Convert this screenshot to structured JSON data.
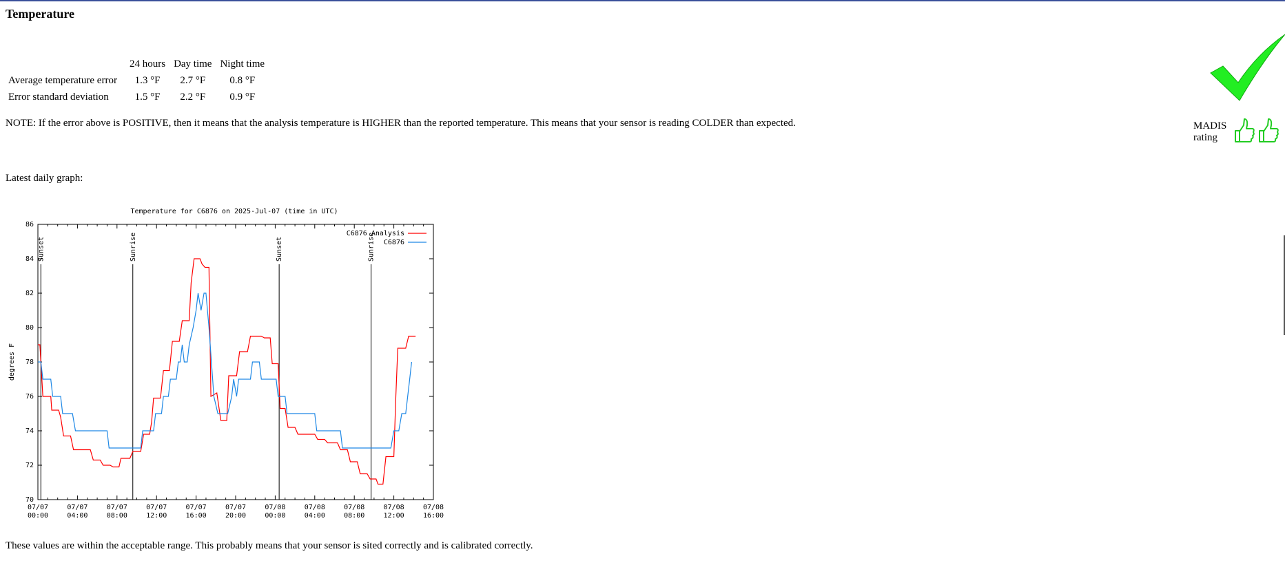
{
  "section": {
    "title": "Temperature"
  },
  "stats": {
    "columns": [
      "",
      "24 hours",
      "Day time",
      "Night time"
    ],
    "rows": [
      {
        "label": "Average temperature error",
        "values": [
          "1.3 °F",
          "2.7 °F",
          "0.8 °F"
        ]
      },
      {
        "label": "Error standard deviation",
        "values": [
          "1.5 °F",
          "2.2 °F",
          "0.9 °F"
        ]
      }
    ]
  },
  "note": "NOTE: If the error above is POSITIVE, then it means that the analysis temperature is HIGHER than the reported temperature. This means that your sensor is reading COLDER than expected.",
  "graph_label": "Latest daily graph:",
  "rating": {
    "line1": "MADIS",
    "line2": "rating",
    "status_icon": "green-checkmark",
    "thumbs_icon": "thumbs-up",
    "color": "#22dd22"
  },
  "footer": "These values are within the acceptable range. This probably means that your sensor is sited correctly and is calibrated correctly.",
  "chart_data": {
    "type": "line",
    "title": "Temperature for C6876 on 2025-Jul-07 (time in UTC)",
    "ylabel": "degrees F",
    "xlabel": "",
    "ylim": [
      70,
      86
    ],
    "xlim": [
      0,
      40
    ],
    "x_unit": "hours since 07/07 00:00 UTC",
    "yticks": [
      70,
      72,
      74,
      76,
      78,
      80,
      82,
      84,
      86
    ],
    "xticks": [
      {
        "x": 0,
        "line1": "07/07",
        "line2": "00:00"
      },
      {
        "x": 4,
        "line1": "07/07",
        "line2": "04:00"
      },
      {
        "x": 8,
        "line1": "07/07",
        "line2": "08:00"
      },
      {
        "x": 12,
        "line1": "07/07",
        "line2": "12:00"
      },
      {
        "x": 16,
        "line1": "07/07",
        "line2": "16:00"
      },
      {
        "x": 20,
        "line1": "07/07",
        "line2": "20:00"
      },
      {
        "x": 24,
        "line1": "07/08",
        "line2": "00:00"
      },
      {
        "x": 28,
        "line1": "07/08",
        "line2": "04:00"
      },
      {
        "x": 32,
        "line1": "07/08",
        "line2": "08:00"
      },
      {
        "x": 36,
        "line1": "07/08",
        "line2": "12:00"
      },
      {
        "x": 40,
        "line1": "07/08",
        "line2": "16:00"
      }
    ],
    "grid": false,
    "legend_position": "top-right",
    "events": [
      {
        "x": 0.3,
        "label": "Sunset"
      },
      {
        "x": 9.6,
        "label": "Sunrise"
      },
      {
        "x": 24.4,
        "label": "Sunset"
      },
      {
        "x": 33.7,
        "label": "Sunrise"
      }
    ],
    "series": [
      {
        "name": "C6876 Analysis",
        "color": "#ff0000",
        "points": [
          [
            0,
            79
          ],
          [
            0.2,
            79
          ],
          [
            0.3,
            78
          ],
          [
            0.5,
            76
          ],
          [
            1.3,
            76
          ],
          [
            1.4,
            75.2
          ],
          [
            2.1,
            75.2
          ],
          [
            2.3,
            74.8
          ],
          [
            2.6,
            73.7
          ],
          [
            3.3,
            73.7
          ],
          [
            3.6,
            72.9
          ],
          [
            5.3,
            72.9
          ],
          [
            5.6,
            72.3
          ],
          [
            6.3,
            72.3
          ],
          [
            6.6,
            72
          ],
          [
            7.3,
            72
          ],
          [
            7.6,
            71.9
          ],
          [
            8.2,
            71.9
          ],
          [
            8.4,
            72.4
          ],
          [
            9.3,
            72.4
          ],
          [
            9.6,
            72.8
          ],
          [
            10.4,
            72.8
          ],
          [
            10.7,
            73.8
          ],
          [
            11.3,
            73.8
          ],
          [
            11.5,
            74.5
          ],
          [
            11.7,
            75.9
          ],
          [
            12.4,
            75.9
          ],
          [
            12.7,
            77.5
          ],
          [
            13.3,
            77.5
          ],
          [
            13.6,
            79.2
          ],
          [
            14.3,
            79.2
          ],
          [
            14.6,
            80.4
          ],
          [
            15.3,
            80.4
          ],
          [
            15.5,
            82.6
          ],
          [
            15.8,
            84
          ],
          [
            16.4,
            84
          ],
          [
            16.6,
            83.7
          ],
          [
            16.9,
            83.5
          ],
          [
            17.3,
            83.5
          ],
          [
            17.5,
            76
          ],
          [
            18.1,
            76.2
          ],
          [
            18.5,
            74.6
          ],
          [
            19.1,
            74.6
          ],
          [
            19.3,
            77.2
          ],
          [
            20.1,
            77.2
          ],
          [
            20.4,
            78.6
          ],
          [
            21.2,
            78.6
          ],
          [
            21.5,
            79.5
          ],
          [
            22.6,
            79.5
          ],
          [
            22.9,
            79.4
          ],
          [
            23.5,
            79.4
          ],
          [
            23.7,
            77.9
          ],
          [
            24.3,
            77.9
          ],
          [
            24.5,
            75.3
          ],
          [
            25.0,
            75.3
          ],
          [
            25.3,
            74.2
          ],
          [
            26.0,
            74.2
          ],
          [
            26.3,
            73.8
          ],
          [
            28.0,
            73.8
          ],
          [
            28.3,
            73.5
          ],
          [
            29.0,
            73.5
          ],
          [
            29.3,
            73.3
          ],
          [
            30.3,
            73.3
          ],
          [
            30.6,
            72.9
          ],
          [
            31.3,
            72.9
          ],
          [
            31.6,
            72.2
          ],
          [
            32.3,
            72.2
          ],
          [
            32.6,
            71.5
          ],
          [
            33.3,
            71.5
          ],
          [
            33.6,
            71.2
          ],
          [
            34.2,
            71.2
          ],
          [
            34.4,
            70.9
          ],
          [
            34.9,
            70.9
          ],
          [
            35.2,
            72.5
          ],
          [
            36.0,
            72.5
          ],
          [
            36.2,
            76.0
          ],
          [
            36.4,
            78.8
          ],
          [
            37.2,
            78.8
          ],
          [
            37.5,
            79.5
          ],
          [
            38.2,
            79.5
          ]
        ]
      },
      {
        "name": "C6876",
        "color": "#1e88e5",
        "points": [
          [
            0,
            78
          ],
          [
            0.3,
            78
          ],
          [
            0.5,
            77
          ],
          [
            1.3,
            77
          ],
          [
            1.5,
            76
          ],
          [
            2.3,
            76
          ],
          [
            2.5,
            75
          ],
          [
            3.5,
            75
          ],
          [
            3.8,
            74
          ],
          [
            7.0,
            74
          ],
          [
            7.2,
            73
          ],
          [
            10.4,
            73
          ],
          [
            10.6,
            74
          ],
          [
            11.7,
            74
          ],
          [
            11.9,
            75
          ],
          [
            12.5,
            75
          ],
          [
            12.7,
            76
          ],
          [
            13.2,
            76
          ],
          [
            13.4,
            77
          ],
          [
            14.0,
            77
          ],
          [
            14.2,
            78
          ],
          [
            14.4,
            78
          ],
          [
            14.6,
            79
          ],
          [
            14.8,
            78
          ],
          [
            15.1,
            78
          ],
          [
            15.3,
            79
          ],
          [
            15.7,
            80
          ],
          [
            16.0,
            81
          ],
          [
            16.2,
            82
          ],
          [
            16.5,
            81
          ],
          [
            16.8,
            82
          ],
          [
            17.0,
            82
          ],
          [
            17.3,
            80
          ],
          [
            17.8,
            76
          ],
          [
            18.2,
            75
          ],
          [
            19.0,
            75
          ],
          [
            19.2,
            75
          ],
          [
            19.6,
            76
          ],
          [
            19.8,
            77
          ],
          [
            20.1,
            76
          ],
          [
            20.3,
            77
          ],
          [
            21.5,
            77
          ],
          [
            21.7,
            78
          ],
          [
            22.4,
            78
          ],
          [
            22.6,
            77
          ],
          [
            24.1,
            77
          ],
          [
            24.3,
            76
          ],
          [
            25.0,
            76
          ],
          [
            25.2,
            75
          ],
          [
            28.0,
            75
          ],
          [
            28.2,
            74
          ],
          [
            30.6,
            74
          ],
          [
            30.8,
            73
          ],
          [
            35.7,
            73
          ],
          [
            36.0,
            74
          ],
          [
            36.5,
            74
          ],
          [
            36.8,
            75
          ],
          [
            37.2,
            75
          ],
          [
            37.4,
            76
          ],
          [
            37.6,
            77
          ],
          [
            37.8,
            78
          ]
        ]
      }
    ]
  }
}
